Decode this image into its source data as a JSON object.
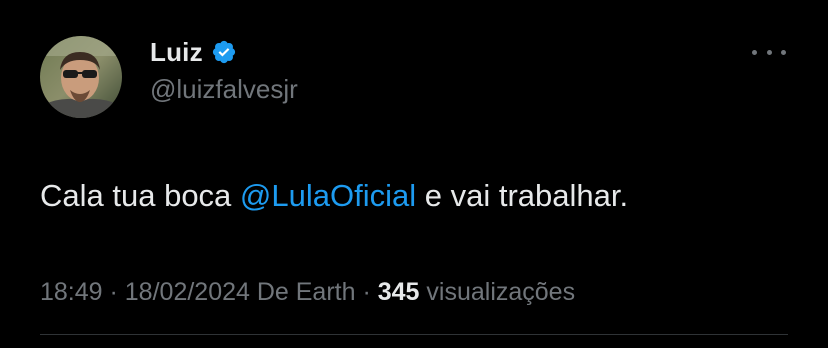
{
  "author": {
    "display_name": "Luiz",
    "handle": "@luizfalvesjr",
    "verified": true,
    "avatar_icon": "profile-photo"
  },
  "tweet": {
    "text_before": "Cala tua boca ",
    "mention": "@LulaOficial",
    "text_after": " e vai trabalhar."
  },
  "meta": {
    "time": "18:49",
    "separator1": " · ",
    "date": "18/02/2024",
    "source": " De Earth",
    "separator2": " · ",
    "views_count": "345",
    "views_label": " visualizações"
  },
  "icons": {
    "more": "more-horizontal-icon",
    "verified": "verified-badge-icon"
  },
  "colors": {
    "background": "#000000",
    "primary_text": "#e7e9ea",
    "secondary_text": "#71767b",
    "accent": "#1d9bf0",
    "divider": "#2f3336"
  }
}
